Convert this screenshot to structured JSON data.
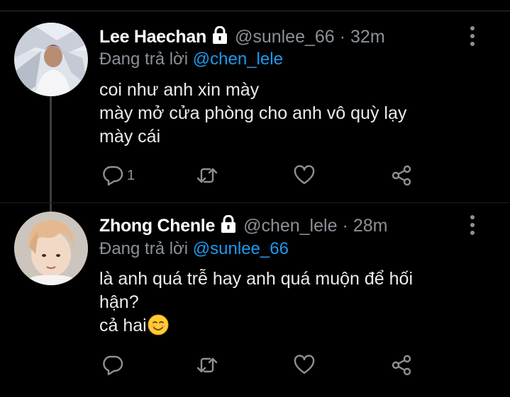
{
  "thread": [
    {
      "display_name": "Lee Haechan",
      "handle": "@sunlee_66",
      "separator": "·",
      "time": "32m",
      "replying_prefix": "Đang trả lời",
      "replying_to": "@chen_lele",
      "text_lines": [
        "coi như anh xin mày",
        "mày mở cửa phòng cho anh vô quỳ lạy",
        "mày cái"
      ],
      "reply_count": "1",
      "retweet_count": "",
      "like_count": ""
    },
    {
      "display_name": "Zhong Chenle",
      "handle": "@chen_lele",
      "separator": "·",
      "time": "28m",
      "replying_prefix": "Đang trả lời",
      "replying_to": "@sunlee_66",
      "text_lines": [
        "là anh quá trễ hay anh quá muộn để hối",
        "hận?",
        "cả hai"
      ],
      "reply_count": "",
      "retweet_count": "",
      "like_count": ""
    }
  ],
  "icons": {
    "reply": "speech-bubble-icon",
    "retweet": "retweet-arrows-icon",
    "like": "heart-icon",
    "share": "share-nodes-icon",
    "lock": "lock-icon",
    "more": "vertical-ellipsis-icon",
    "emoji": "smiling-face-emoji"
  },
  "colors": {
    "background": "#000000",
    "text": "#ebebeb",
    "secondary_text": "#8b9197",
    "mention": "#1d9bf0",
    "thread_line": "#3a3d40"
  }
}
